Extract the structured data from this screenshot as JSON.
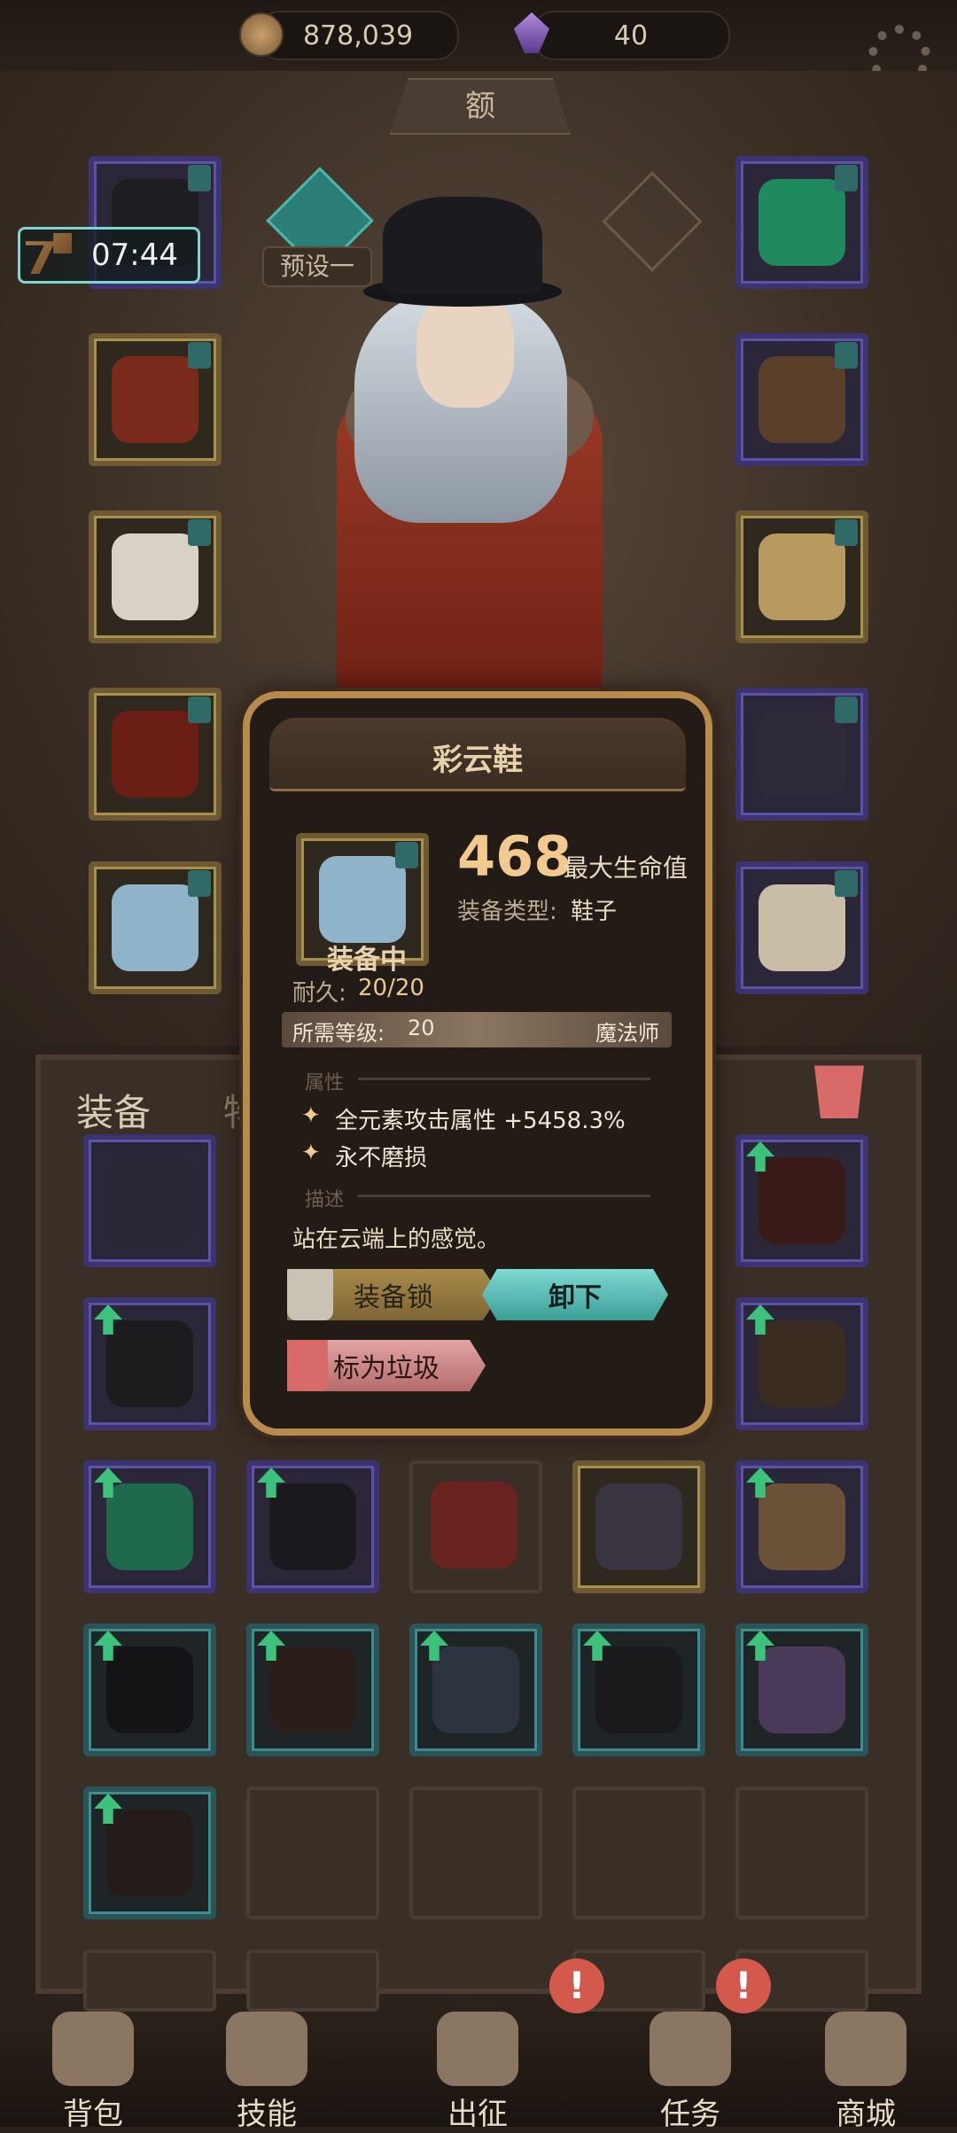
{
  "currencies": {
    "coins": "878,039",
    "gems": "40"
  },
  "banner": {
    "text": "额"
  },
  "timer": {
    "text": "07:44"
  },
  "preset": {
    "label": "预设一"
  },
  "popup": {
    "title": "彩云鞋",
    "stat_value": "468",
    "stat_name": "最大生命值",
    "type_label": "装备类型:",
    "type_value": "鞋子",
    "equipped_label": "装备中",
    "durability_label": "耐久:",
    "durability_value": "20/20",
    "req_label": "所需等级:",
    "req_value": "20",
    "class_name": "魔法师",
    "attr_section": "属性",
    "attributes": [
      "全元素攻击属性 +5458.3%",
      "永不磨损"
    ],
    "desc_section": "描述",
    "description": "站在云端上的感觉。",
    "lock_button": "装备锁",
    "unequip_button": "卸下",
    "junk_button": "标为垃圾"
  },
  "inventory_tabs": {
    "equipment": "装备",
    "items": "物品"
  },
  "nav": {
    "items": [
      {
        "label": "背包"
      },
      {
        "label": "技能"
      },
      {
        "label": "出征"
      },
      {
        "label": "任务"
      },
      {
        "label": "商城"
      }
    ],
    "badge_text": "!"
  },
  "colors": {
    "accent_gold": "#b78a4d",
    "teal": "#3f8c8d",
    "upgrade_green": "#3cc27a",
    "alert_red": "#d3594d"
  }
}
